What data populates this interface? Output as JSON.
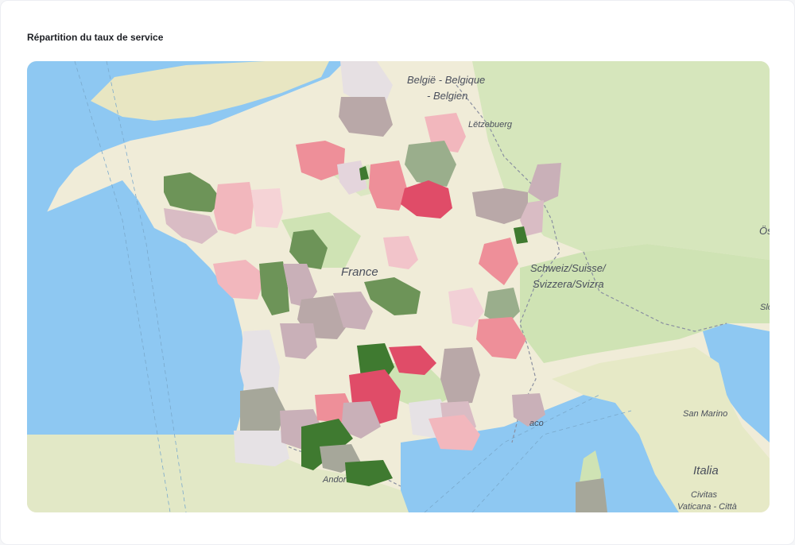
{
  "card": {
    "title": "Répartition du taux de service"
  },
  "map": {
    "labels": {
      "belgium_line1": "België - Belgique",
      "belgium_line2": "- Belgien",
      "luxembourg": "Lëtzebuerg",
      "france": "France",
      "switzerland_line1": "Schweiz/Suisse/",
      "switzerland_line2": "Svizzera/Svizra",
      "austria": "Ös",
      "slovenia": "Slo",
      "monaco": "aco",
      "san_marino": "San Marino",
      "italy": "Italia",
      "vatican_line1": "Civitas",
      "vatican_line2": "Vaticana - Città",
      "andorra": "Andor"
    },
    "colors": {
      "water": "#8ec8f2",
      "land_light": "#f0ecd8",
      "land_green": "#cfe3b4",
      "very_low": "#e04c68",
      "low": "#ee8f99",
      "mid_low": "#f2b7bd",
      "neutral_pink": "#d9bcc4",
      "neutral_grey": "#b9a8a8",
      "mid_green": "#9aae8c",
      "high": "#6d9458",
      "very_high": "#3f7a30"
    }
  }
}
